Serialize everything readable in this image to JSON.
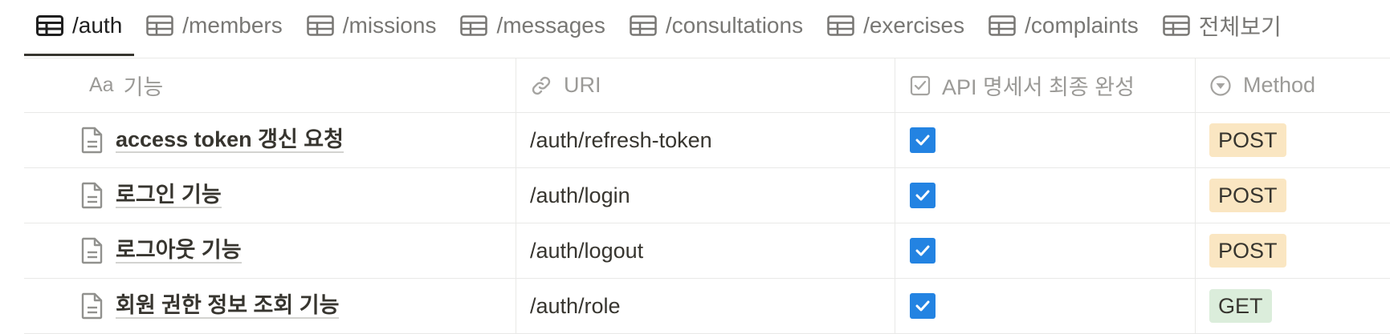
{
  "tabs": [
    {
      "label": "/auth",
      "active": true
    },
    {
      "label": "/members",
      "active": false
    },
    {
      "label": "/missions",
      "active": false
    },
    {
      "label": "/messages",
      "active": false
    },
    {
      "label": "/consultations",
      "active": false
    },
    {
      "label": "/exercises",
      "active": false
    },
    {
      "label": "/complaints",
      "active": false
    },
    {
      "label": "전체보기",
      "active": false
    }
  ],
  "columns": {
    "feature": {
      "prefix": "Aa",
      "label": "기능",
      "icon": "text-type-icon"
    },
    "uri": {
      "label": "URI",
      "icon": "link-icon"
    },
    "spec_done": {
      "label": "API 명세서 최종 완성",
      "icon": "checkbox-icon"
    },
    "method": {
      "label": "Method",
      "icon": "select-icon"
    }
  },
  "rows": [
    {
      "name": "access token 갱신 요청",
      "uri": "/auth/refresh-token",
      "checked": true,
      "method": "POST"
    },
    {
      "name": "로그인 기능",
      "uri": "/auth/login",
      "checked": true,
      "method": "POST"
    },
    {
      "name": "로그아웃 기능",
      "uri": "/auth/logout",
      "checked": true,
      "method": "POST"
    },
    {
      "name": "회원 권한 정보 조회 기능",
      "uri": "/auth/role",
      "checked": true,
      "method": "GET"
    }
  ],
  "colors": {
    "checkbox": "#2383e2",
    "post_tag": "#fae6c2",
    "get_tag": "#dbeddb",
    "active_tab_underline": "#37352f"
  }
}
